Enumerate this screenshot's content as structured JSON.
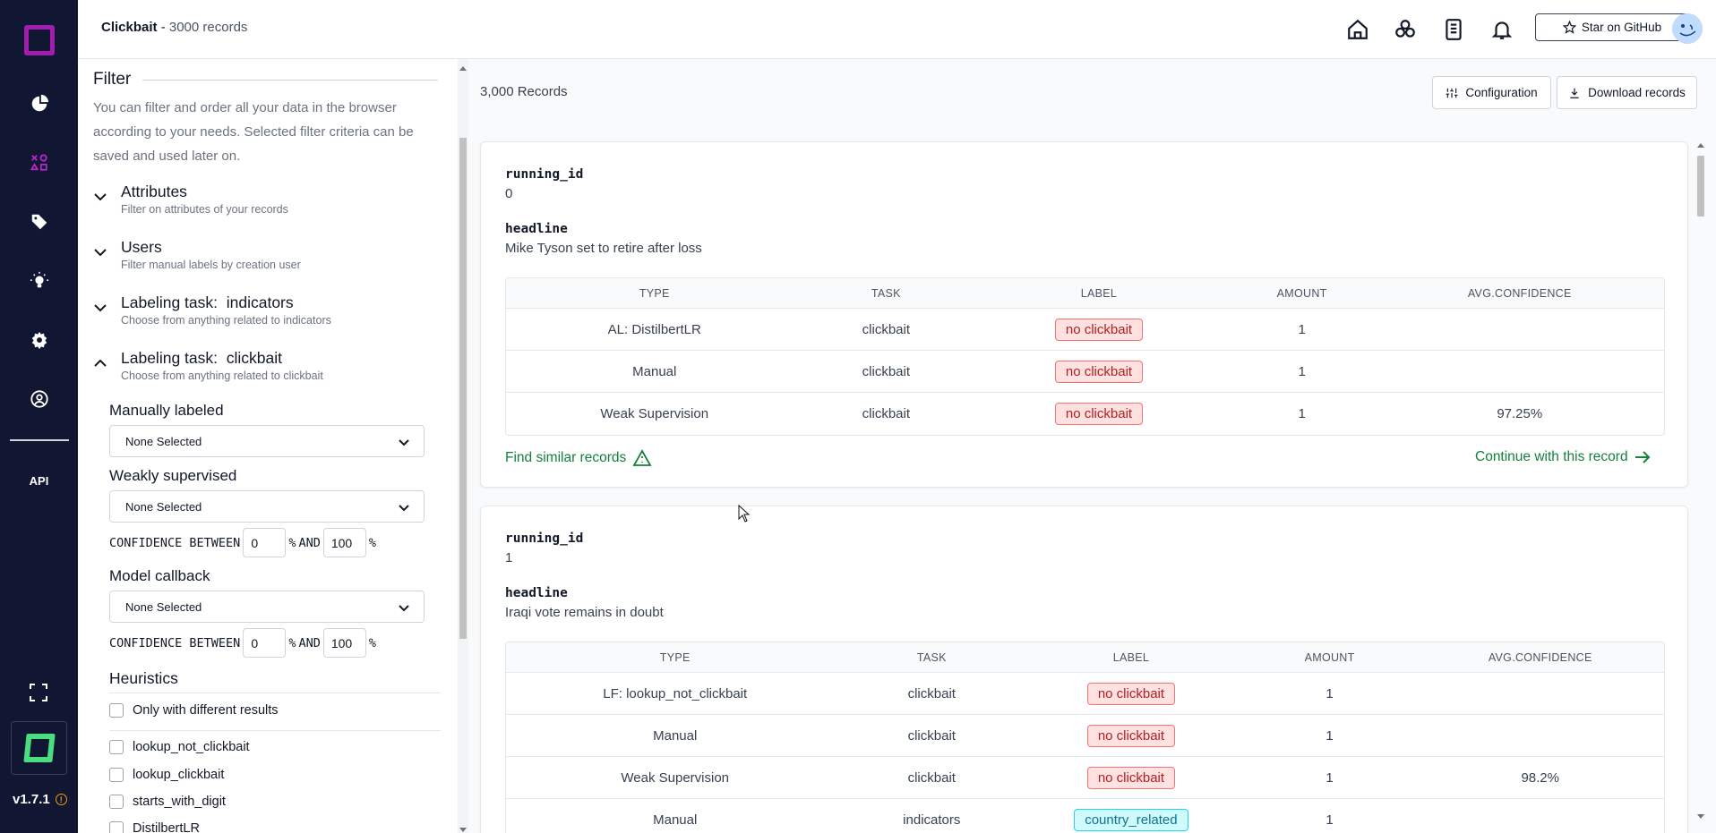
{
  "nav": {
    "items": [
      "logo-icon",
      "chart-pie-icon",
      "shapes-icon",
      "tag-icon",
      "lightbulb-icon",
      "settings-icon",
      "user-circle-icon"
    ],
    "api_label": "API",
    "version": "v1.7.1"
  },
  "header": {
    "project": "Clickbait",
    "separator": " - ",
    "record_count": "3000 records",
    "star_label": "Star on GitHub"
  },
  "filter": {
    "title": "Filter",
    "description": "You can filter and order all your data in the browser according to your needs. Selected filter criteria can be saved and used later on.",
    "sections": [
      {
        "title": "Attributes",
        "subtitle": "Filter on attributes of your records",
        "prefix": "",
        "name": ""
      },
      {
        "title": "Users",
        "subtitle": "Filter manual labels by creation user",
        "prefix": "",
        "name": ""
      },
      {
        "title": "Labeling task:",
        "name": "indicators",
        "subtitle": "Choose from anything related to indicators"
      },
      {
        "title": "Labeling task:",
        "name": "clickbait",
        "subtitle": "Choose from anything related to clickbait"
      }
    ],
    "manually_labeled": {
      "label": "Manually labeled",
      "value": "None Selected"
    },
    "weakly_supervised": {
      "label": "Weakly supervised",
      "value": "None Selected"
    },
    "model_callback": {
      "label": "Model callback",
      "value": "None Selected"
    },
    "confidence": {
      "label": "CONFIDENCE BETWEEN",
      "pct": "%",
      "and": "AND",
      "min": "0",
      "max": "100"
    },
    "heuristics": {
      "title": "Heuristics",
      "only_diff": "Only with different results",
      "items": [
        "lookup_not_clickbait",
        "lookup_clickbait",
        "starts_with_digit",
        "DistilbertLR"
      ]
    }
  },
  "main": {
    "records_label": "3,000 Records",
    "config_label": "Configuration",
    "download_label": "Download records",
    "columns": [
      "TYPE",
      "TASK",
      "LABEL",
      "AMOUNT",
      "AVG.CONFIDENCE"
    ],
    "find_similar": "Find similar records",
    "continue": "Continue with this record",
    "records": [
      {
        "key1": "running_id",
        "val1": "0",
        "key2": "headline",
        "val2": "Mike Tyson set to retire after loss",
        "rows": [
          {
            "type": "AL: DistilbertLR",
            "task": "clickbait",
            "label": "no clickbait",
            "amount": "1",
            "conf": ""
          },
          {
            "type": "Manual",
            "task": "clickbait",
            "label": "no clickbait",
            "amount": "1",
            "conf": ""
          },
          {
            "type": "Weak Supervision",
            "task": "clickbait",
            "label": "no clickbait",
            "amount": "1",
            "conf": "97.25%"
          }
        ]
      },
      {
        "key1": "running_id",
        "val1": "1",
        "key2": "headline",
        "val2": "Iraqi vote remains in doubt",
        "rows": [
          {
            "type": "LF: lookup_not_clickbait",
            "task": "clickbait",
            "label": "no clickbait",
            "amount": "1",
            "conf": ""
          },
          {
            "type": "Manual",
            "task": "clickbait",
            "label": "no clickbait",
            "amount": "1",
            "conf": ""
          },
          {
            "type": "Weak Supervision",
            "task": "clickbait",
            "label": "no clickbait",
            "amount": "1",
            "conf": "98.2%"
          },
          {
            "type": "Manual",
            "task": "indicators",
            "label": "country_related",
            "amount": "1",
            "conf": ""
          }
        ]
      }
    ]
  },
  "colors": {
    "nav_bg": "#111633",
    "accent_purple": "#a21caf",
    "brand_green": "#4ade80",
    "link_green": "#15803d",
    "badge_red": "#b91c1c",
    "badge_cyan": "#0e7490"
  }
}
